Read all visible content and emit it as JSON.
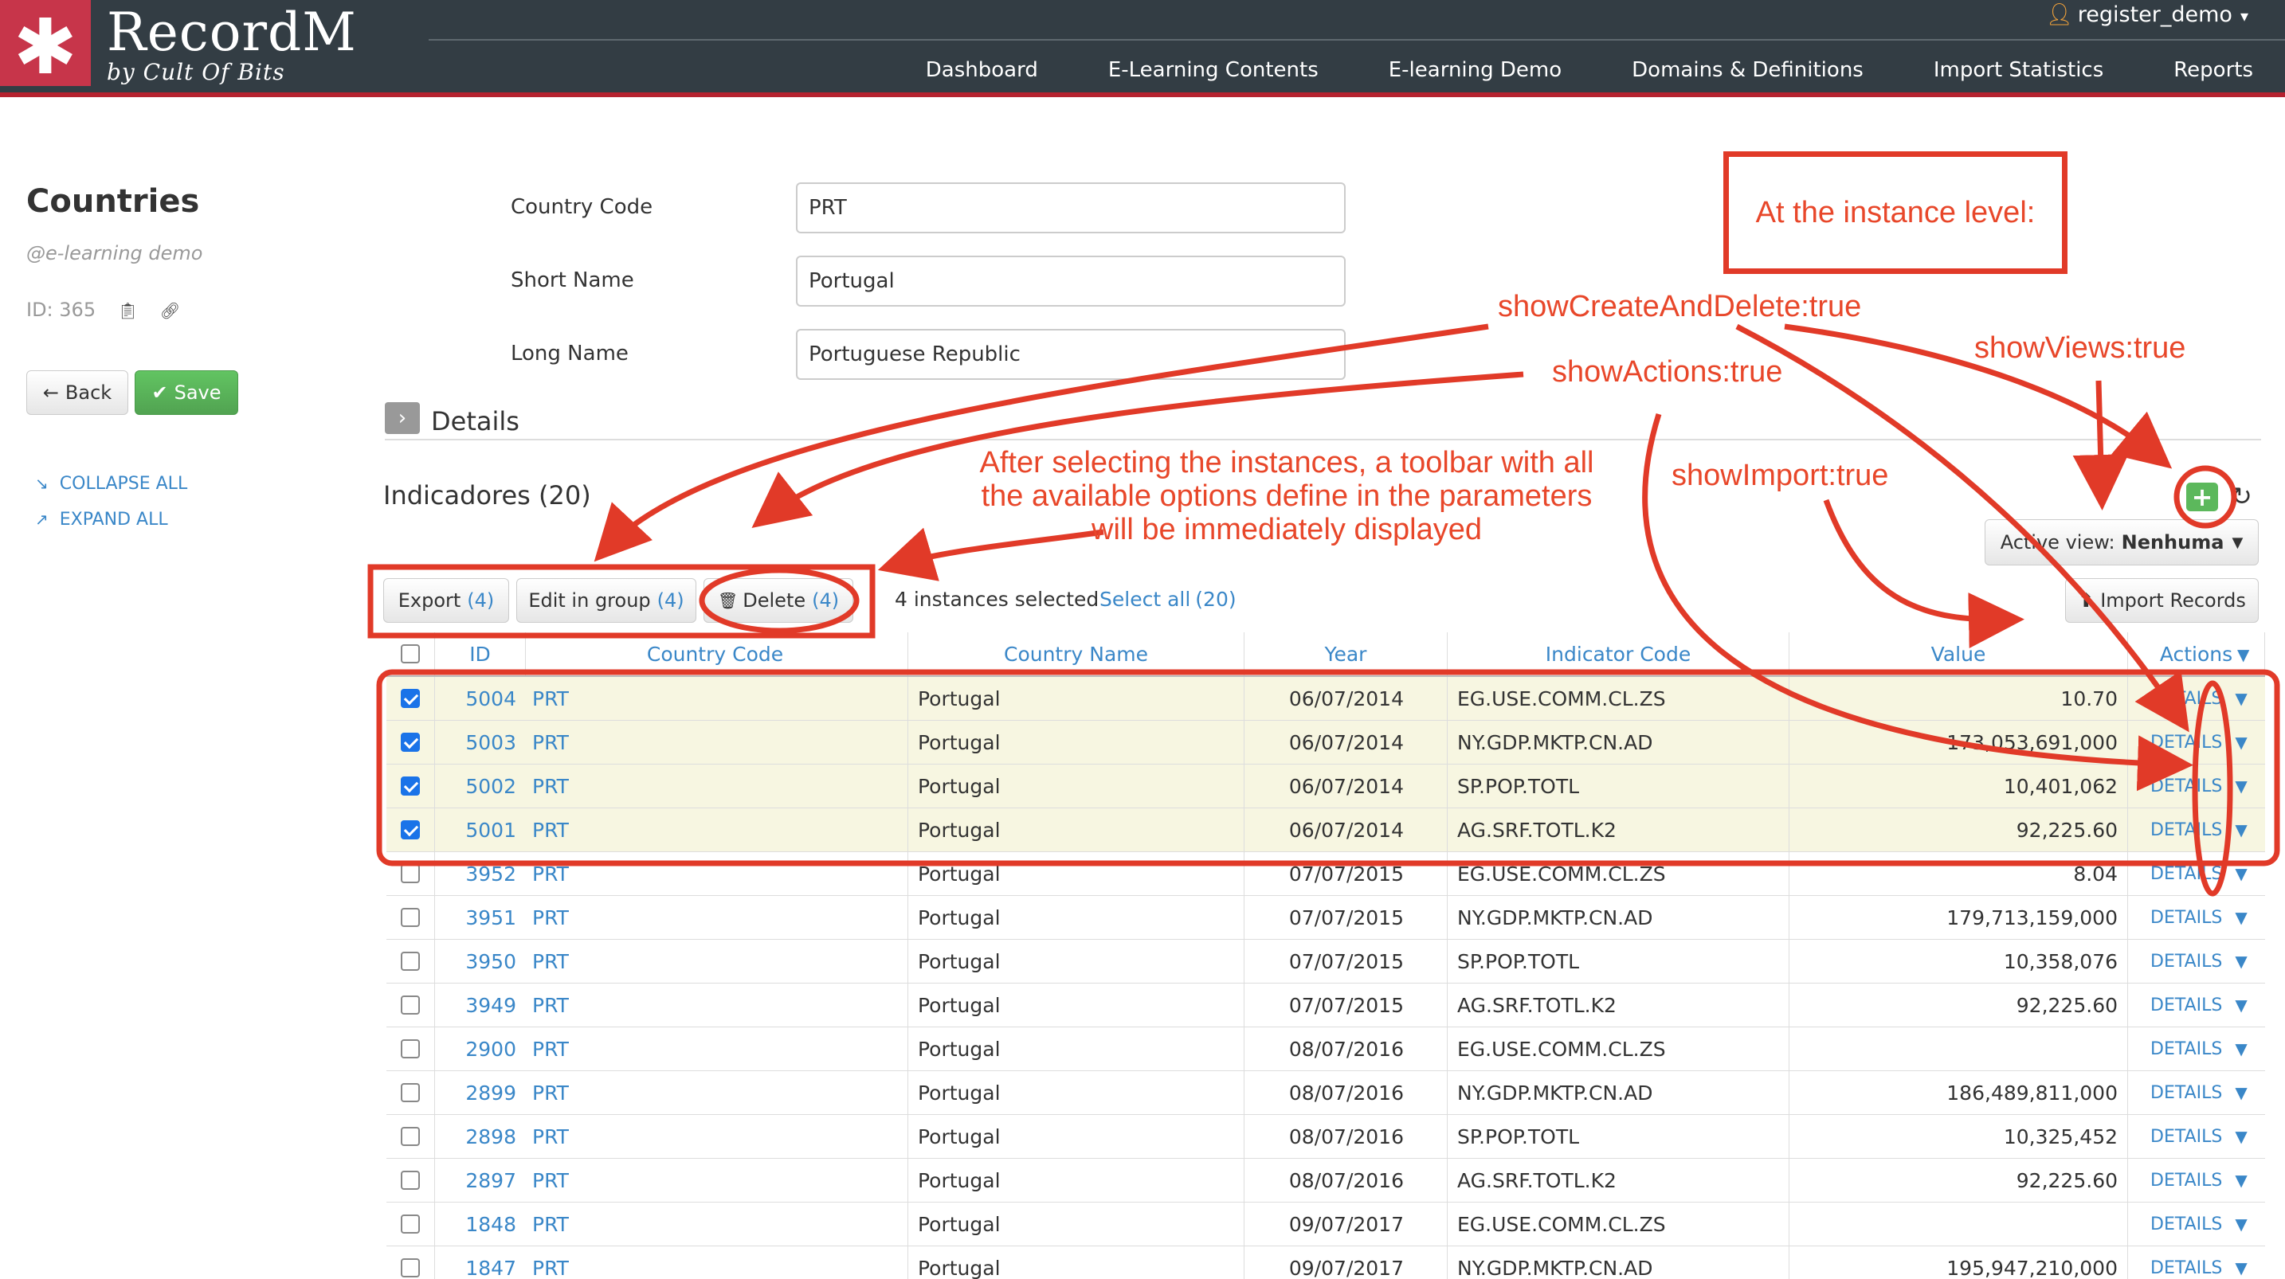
{
  "header": {
    "logo_symbol": "✱",
    "brand": "RecordM",
    "brand_sub": "by Cult Of Bits",
    "user": "register_demo",
    "nav": [
      "Dashboard",
      "E-Learning Contents",
      "E-learning Demo",
      "Domains & Definitions",
      "Import Statistics",
      "Reports"
    ]
  },
  "sidebar": {
    "title": "Countries",
    "domain": "@e-learning demo",
    "id_label": "ID: 365",
    "back_label": "Back",
    "save_label": "Save",
    "collapse_label": "COLLAPSE ALL",
    "expand_label": "EXPAND ALL"
  },
  "form": {
    "country_code_label": "Country Code",
    "country_code_value": "PRT",
    "short_name_label": "Short Name",
    "short_name_value": "Portugal",
    "long_name_label": "Long Name",
    "long_name_value": "Portuguese Republic",
    "details_label": "Details"
  },
  "indicators": {
    "title": "Indicadores (20)",
    "export_label": "Export",
    "export_count": "(4)",
    "edit_label": "Edit in group",
    "edit_count": "(4)",
    "delete_label": "Delete",
    "delete_count": "(4)",
    "selected_text": "4 instances selected",
    "select_all_label": "Select all",
    "select_all_count": "(20)",
    "active_view_label": "Active view:",
    "active_view_value": "Nenhuma",
    "import_label": "Import Records",
    "columns": [
      "ID",
      "Country Code",
      "Country Name",
      "Year",
      "Indicator Code",
      "Value",
      "Actions"
    ],
    "details_action": "DETAILS",
    "rows": [
      {
        "id": "5004",
        "cc": "PRT",
        "name": "Portugal",
        "year": "06/07/2014",
        "code": "EG.USE.COMM.CL.ZS",
        "value": "10.70",
        "selected": true
      },
      {
        "id": "5003",
        "cc": "PRT",
        "name": "Portugal",
        "year": "06/07/2014",
        "code": "NY.GDP.MKTP.CN.AD",
        "value": "173,053,691,000",
        "selected": true
      },
      {
        "id": "5002",
        "cc": "PRT",
        "name": "Portugal",
        "year": "06/07/2014",
        "code": "SP.POP.TOTL",
        "value": "10,401,062",
        "selected": true
      },
      {
        "id": "5001",
        "cc": "PRT",
        "name": "Portugal",
        "year": "06/07/2014",
        "code": "AG.SRF.TOTL.K2",
        "value": "92,225.60",
        "selected": true
      },
      {
        "id": "3952",
        "cc": "PRT",
        "name": "Portugal",
        "year": "07/07/2015",
        "code": "EG.USE.COMM.CL.ZS",
        "value": "8.04",
        "selected": false
      },
      {
        "id": "3951",
        "cc": "PRT",
        "name": "Portugal",
        "year": "07/07/2015",
        "code": "NY.GDP.MKTP.CN.AD",
        "value": "179,713,159,000",
        "selected": false
      },
      {
        "id": "3950",
        "cc": "PRT",
        "name": "Portugal",
        "year": "07/07/2015",
        "code": "SP.POP.TOTL",
        "value": "10,358,076",
        "selected": false
      },
      {
        "id": "3949",
        "cc": "PRT",
        "name": "Portugal",
        "year": "07/07/2015",
        "code": "AG.SRF.TOTL.K2",
        "value": "92,225.60",
        "selected": false
      },
      {
        "id": "2900",
        "cc": "PRT",
        "name": "Portugal",
        "year": "08/07/2016",
        "code": "EG.USE.COMM.CL.ZS",
        "value": "",
        "selected": false
      },
      {
        "id": "2899",
        "cc": "PRT",
        "name": "Portugal",
        "year": "08/07/2016",
        "code": "NY.GDP.MKTP.CN.AD",
        "value": "186,489,811,000",
        "selected": false
      },
      {
        "id": "2898",
        "cc": "PRT",
        "name": "Portugal",
        "year": "08/07/2016",
        "code": "SP.POP.TOTL",
        "value": "10,325,452",
        "selected": false
      },
      {
        "id": "2897",
        "cc": "PRT",
        "name": "Portugal",
        "year": "08/07/2016",
        "code": "AG.SRF.TOTL.K2",
        "value": "92,225.60",
        "selected": false
      },
      {
        "id": "1848",
        "cc": "PRT",
        "name": "Portugal",
        "year": "09/07/2017",
        "code": "EG.USE.COMM.CL.ZS",
        "value": "",
        "selected": false
      },
      {
        "id": "1847",
        "cc": "PRT",
        "name": "Portugal",
        "year": "09/07/2017",
        "code": "NY.GDP.MKTP.CN.AD",
        "value": "195,947,210,000",
        "selected": false
      }
    ]
  },
  "annotations": {
    "instance_level": "At the instance level:",
    "show_create_delete": "showCreateAndDelete:true",
    "show_actions": "showActions:true",
    "show_views": "showViews:true",
    "show_import": "showImport:true",
    "toolbar_note": "After selecting the instances, a toolbar with all the available options define in the parameters will be immediately displayed",
    "color": "#e8472a"
  }
}
